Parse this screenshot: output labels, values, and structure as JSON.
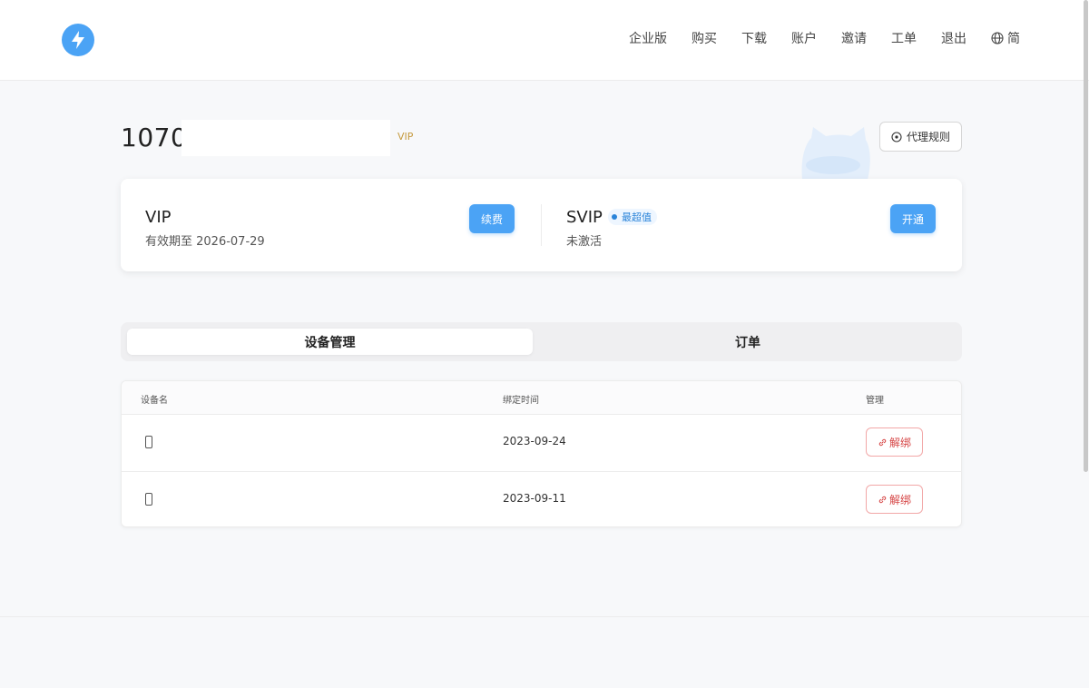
{
  "header": {
    "nav": [
      "企业版",
      "购买",
      "下载",
      "账户",
      "邀请",
      "工单",
      "退出"
    ],
    "lang": "简"
  },
  "account": {
    "id": "1070",
    "tag": "VIP",
    "proxy_rules_label": "代理规则"
  },
  "plans": {
    "vip": {
      "name": "VIP",
      "status": "有效期至 2026-07-29",
      "button": "续费"
    },
    "svip": {
      "name": "SVIP",
      "badge": "最超值",
      "status": "未激活",
      "button": "开通"
    }
  },
  "tabs": [
    {
      "label": "设备管理",
      "active": true
    },
    {
      "label": "订单",
      "active": false
    }
  ],
  "devices": {
    "columns": [
      "设备名",
      "绑定时间",
      "管理"
    ],
    "rows": [
      {
        "name": "",
        "bound_date": "2023-09-24",
        "action": "解绑"
      },
      {
        "name": "",
        "bound_date": "2023-09-11",
        "action": "解绑"
      }
    ]
  },
  "colors": {
    "accent": "#4ba3f5",
    "danger": "#d64545",
    "vip_gold": "#c59a3e"
  }
}
